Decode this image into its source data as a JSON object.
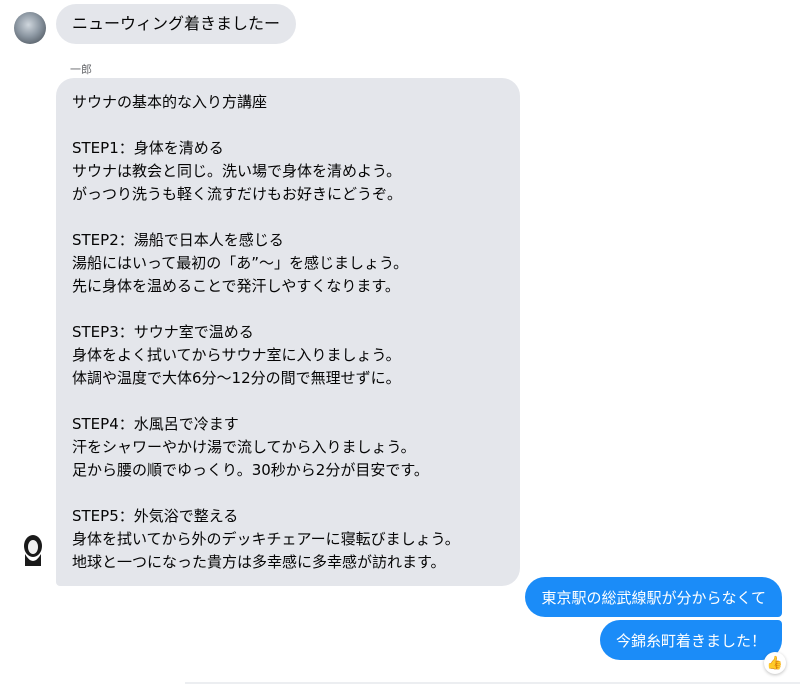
{
  "conversation": {
    "first_message": "ニューウィング着きましたー",
    "sender_name": "一郎",
    "main_message_lines": [
      "サウナの基本的な入り方講座",
      "",
      "STEP1：身体を清める",
      "サウナは教会と同じ。洗い場で身体を清めよう。",
      "がっつり洗うも軽く流すだけもお好きにどうぞ。",
      "",
      "STEP2：湯船で日本人を感じる",
      "湯船にはいって最初の「あ”〜」を感じましょう。",
      "先に身体を温めることで発汗しやすくなります。",
      "",
      "STEP3：サウナ室で温める",
      "身体をよく拭いてからサウナ室に入りましょう。",
      "体調や温度で大体6分〜12分の間で無理せずに。",
      "",
      "STEP4：水風呂で冷ます",
      "汗をシャワーやかけ湯で流してから入りましょう。",
      "足から腰の順でゆっくり。30秒から2分が目安です。",
      "",
      "STEP5：外気浴で整える",
      "身体を拭いてから外のデッキチェアーに寝転びましょう。",
      "地球と一つになった貴方は多幸感に多幸感が訪れます。"
    ],
    "outgoing_messages": [
      "東京駅の総武線駅が分からなくて",
      "今錦糸町着きました！"
    ],
    "reaction_icon": "thumbs-up-icon"
  },
  "colors": {
    "incoming_bubble": "#e4e6eb",
    "outgoing_bubble": "#1b8cf8",
    "sender_name": "#65676b"
  }
}
